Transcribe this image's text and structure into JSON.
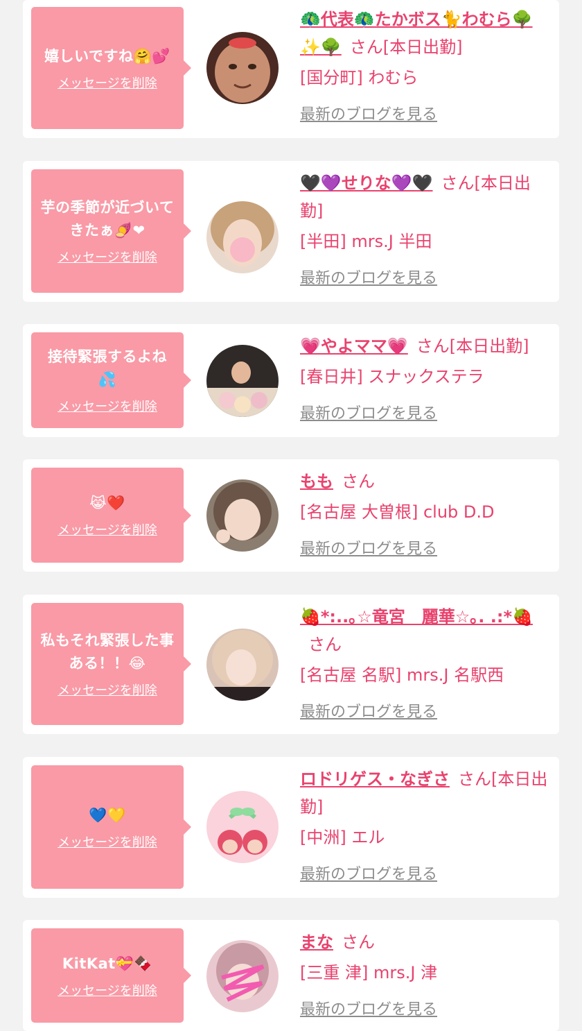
{
  "delete_label": "メッセージを削除",
  "blog_label": "最新のブログを見る",
  "name_suffix": "さん",
  "cards": [
    {
      "message": "嬉しいですね🤗💕",
      "name": "🦚代表🦚たかボス🐈わむら🌳✨🌳",
      "suffix": "さん[本日出勤]",
      "shop": "[国分町] わむら"
    },
    {
      "message": "芋の季節が近づいてきたぁ🍠❤",
      "name": "🖤💜せりな💜🖤",
      "suffix": "さん[本日出勤]",
      "shop": "[半田] mrs.J 半田"
    },
    {
      "message": "接待緊張するよね💦",
      "name": "💗やよママ💗",
      "suffix": "さん[本日出勤]",
      "shop": "[春日井] スナックステラ"
    },
    {
      "message": "😹❤️",
      "name": "もも",
      "suffix": "さん",
      "shop": "[名古屋 大曽根] club D.D"
    },
    {
      "message": "私もそれ緊張した事ある！！😂",
      "name": "🍓*:..｡☆竜宮　麗華☆｡. .:*🍓",
      "suffix": "さん",
      "shop": "[名古屋 名駅] mrs.J 名駅西"
    },
    {
      "message": "💙💛",
      "name": "ロドリゲス・なぎさ",
      "suffix": "さん[本日出勤]",
      "shop": "[中洲] エル"
    },
    {
      "message": "KitKat💝🍫",
      "name": "まな",
      "suffix": "さん",
      "shop": "[三重 津] mrs.J 津"
    }
  ],
  "colors": {
    "background": "#f2f2f2",
    "bubble": "#f99aa6",
    "accent": "#e8426d",
    "blog_link": "#8c8c8c"
  }
}
